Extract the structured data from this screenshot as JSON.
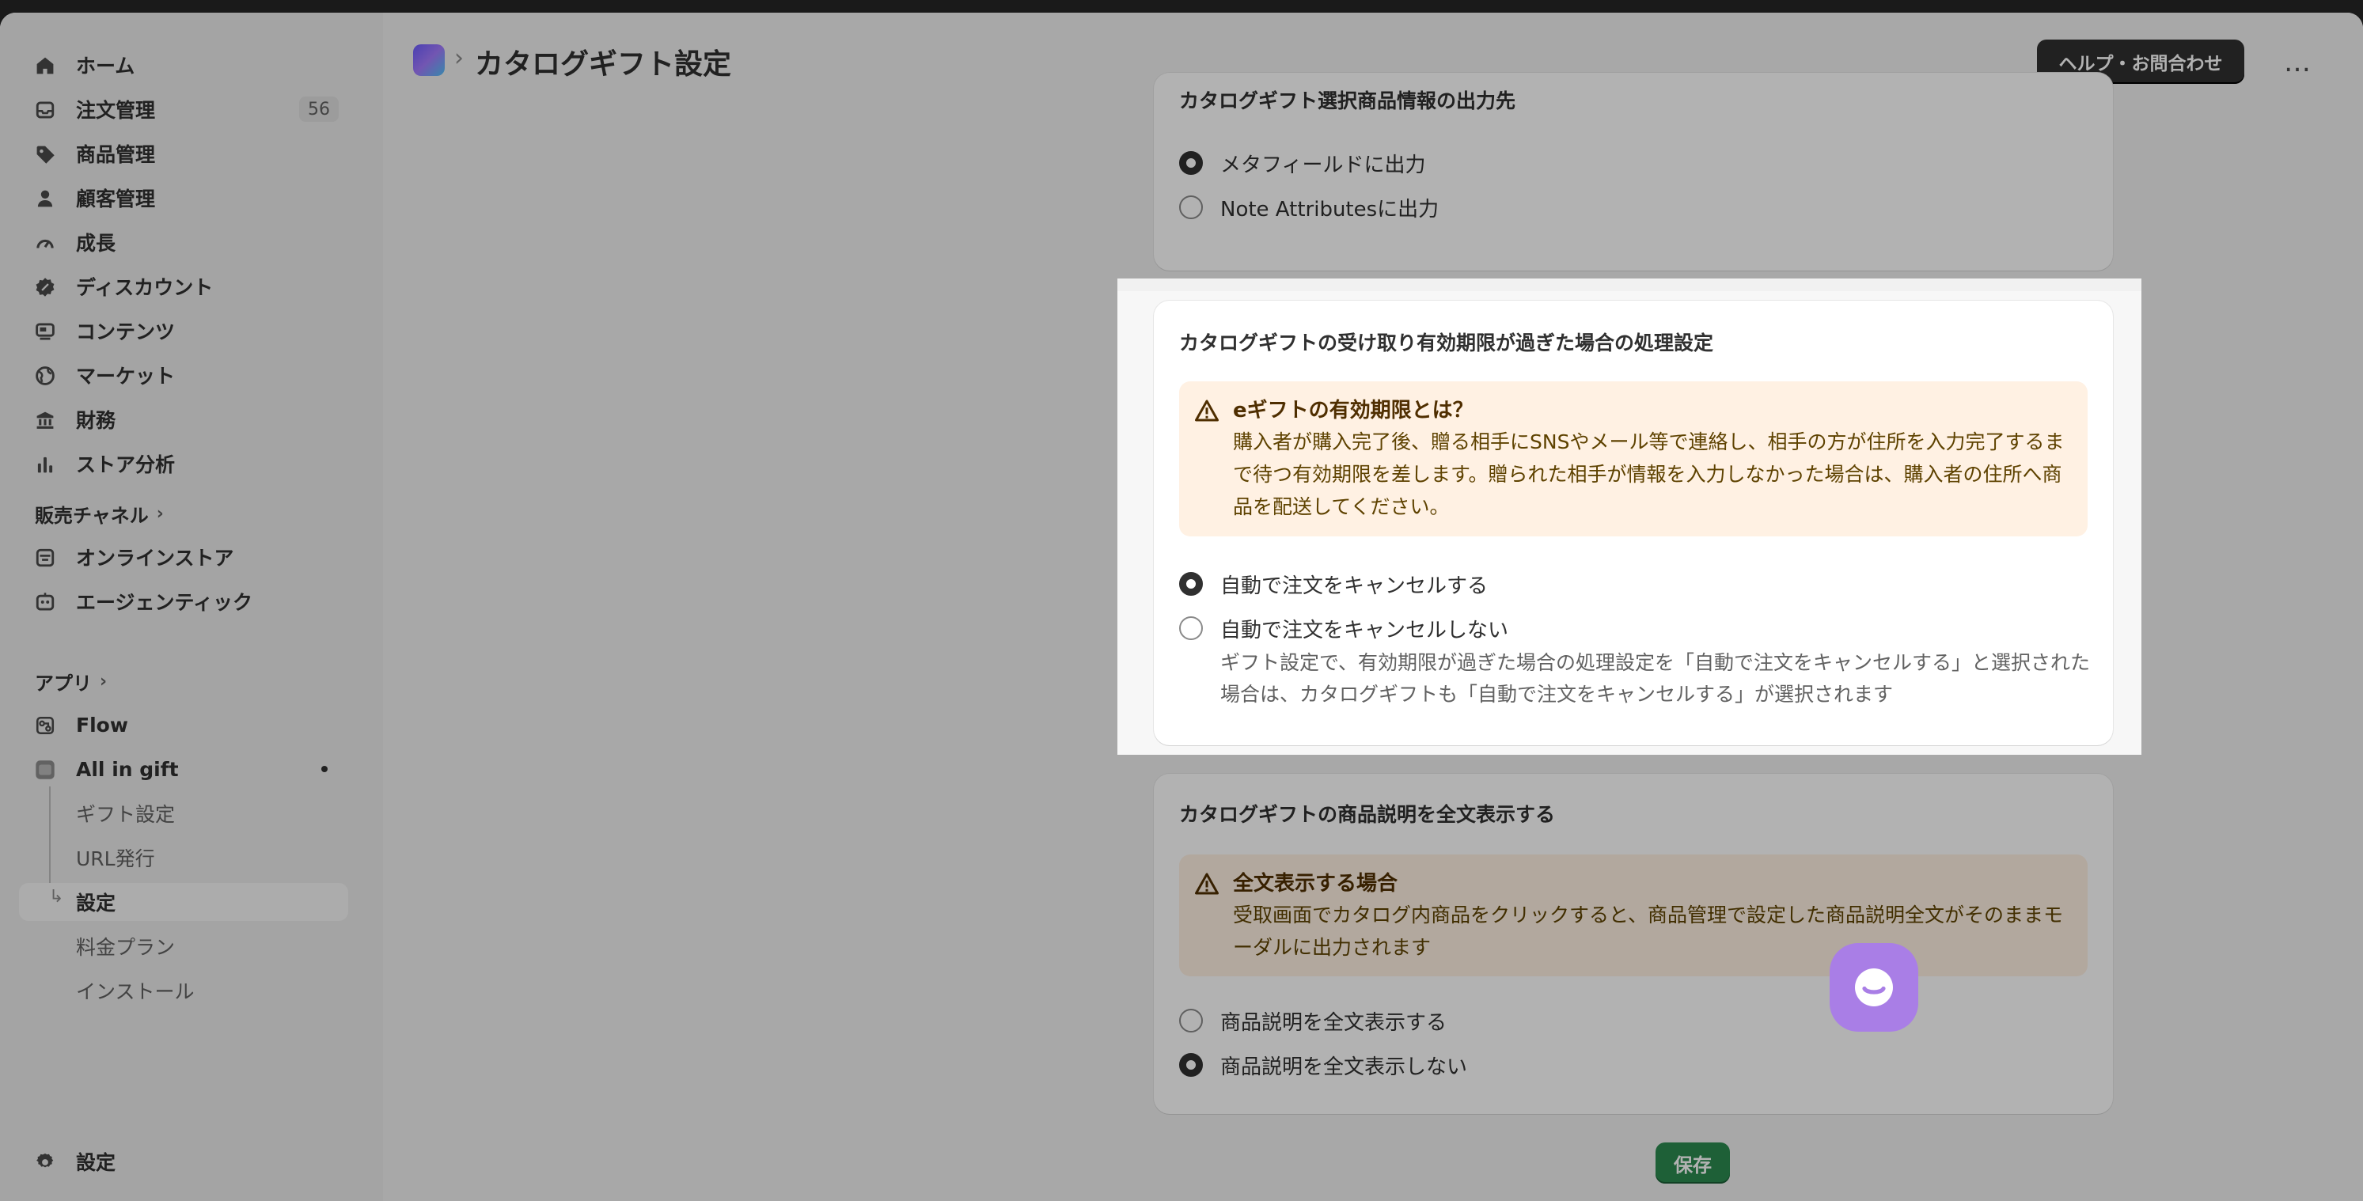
{
  "sidebar": {
    "items": [
      {
        "label": "ホーム",
        "icon": "home-icon"
      },
      {
        "label": "注文管理",
        "icon": "inbox-icon",
        "badge": "56"
      },
      {
        "label": "商品管理",
        "icon": "tag-icon"
      },
      {
        "label": "顧客管理",
        "icon": "person-icon"
      },
      {
        "label": "成長",
        "icon": "gauge-icon"
      },
      {
        "label": "ディスカウント",
        "icon": "discount-icon"
      },
      {
        "label": "コンテンツ",
        "icon": "content-icon"
      },
      {
        "label": "マーケット",
        "icon": "globe-icon"
      },
      {
        "label": "財務",
        "icon": "bank-icon"
      },
      {
        "label": "ストア分析",
        "icon": "bar-chart-icon"
      }
    ],
    "sales_channels_label": "販売チャネル",
    "channels": [
      {
        "label": "オンラインストア",
        "icon": "store-icon"
      },
      {
        "label": "エージェンティック",
        "icon": "agent-icon"
      }
    ],
    "apps_label": "アプリ",
    "apps": [
      {
        "label": "Flow",
        "icon": "flow-icon"
      },
      {
        "label": "All in gift",
        "icon": "all-in-gift-app-icon"
      }
    ],
    "app_subitems": [
      "ギフト設定",
      "URL発行",
      "設定",
      "料金プラン",
      "インストール"
    ],
    "settings_label": "設定"
  },
  "header": {
    "title": "カタログギフト設定",
    "help_button": "ヘルプ・お問合わせ",
    "more_label": "…"
  },
  "cards": {
    "output": {
      "title": "カタログギフト選択商品情報の出力先",
      "options": [
        "メタフィールドに出力",
        "Note Attributesに出力"
      ],
      "selected": 0
    },
    "expiry": {
      "title": "カタログギフトの受け取り有効期限が過ぎた場合の処理設定",
      "banner_title": "eギフトの有効期限とは？",
      "banner_body": "購入者が購入完了後、贈る相手にSNSやメール等で連絡し、相手の方が住所を入力完了するまで待つ有効期限を差します。贈られた相手が情報を入力しなかった場合は、購入者の住所へ商品を配送してください。",
      "options": [
        "自動で注文をキャンセルする",
        "自動で注文をキャンセルしない"
      ],
      "selected": 0,
      "help": "ギフト設定で、有効期限が過ぎた場合の処理設定を「自動で注文をキャンセルする」と選択された場合は、カタログギフトも「自動で注文をキャンセルする」が選択されます"
    },
    "description": {
      "title": "カタログギフトの商品説明を全文表示する",
      "banner_title": "全文表示する場合",
      "banner_body": "受取画面でカタログ内商品をクリックすると、商品管理で設定した商品説明全文がそのままモーダルに出力されます",
      "options": [
        "商品説明を全文表示する",
        "商品説明を全文表示しない"
      ],
      "selected": 1
    }
  },
  "save_button": "保存",
  "colors": {
    "accent_dark": "#303030",
    "save_green": "#2b8a4f",
    "banner_bg": "#fff1e3",
    "chat_purple": "#a97ee6"
  }
}
